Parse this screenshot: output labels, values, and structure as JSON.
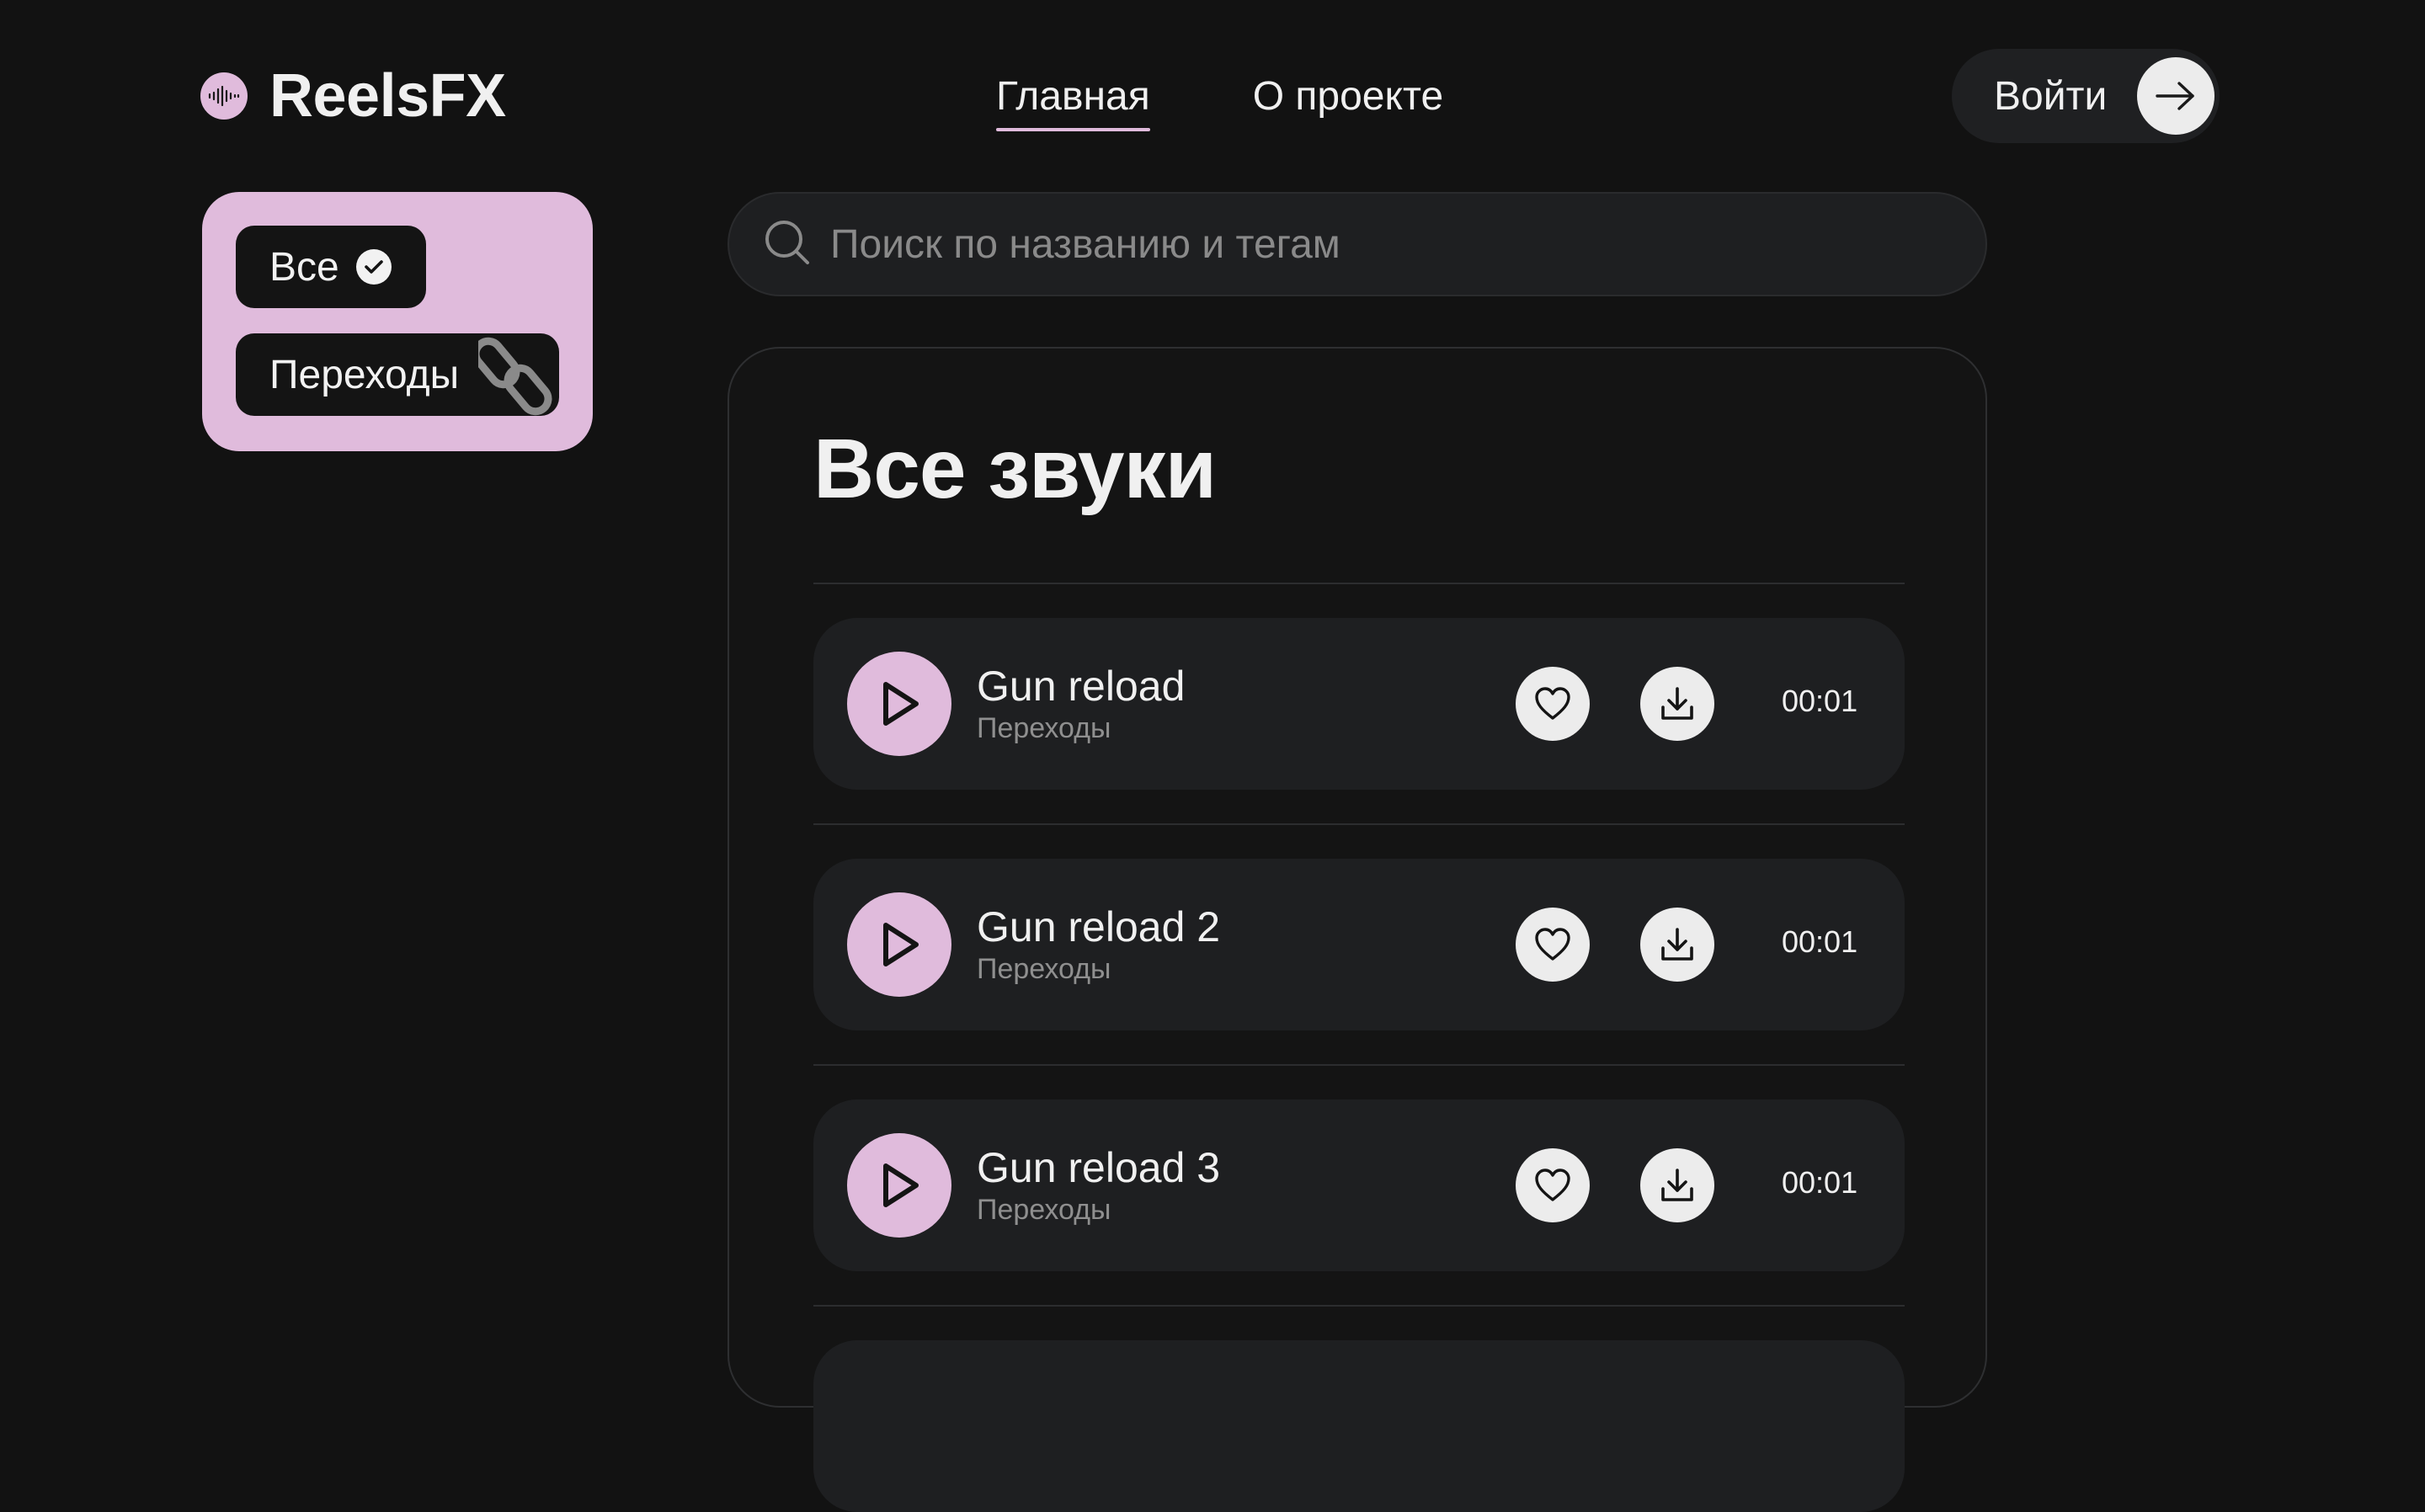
{
  "header": {
    "logo_text": "ReelsFX",
    "nav": [
      {
        "label": "Главная",
        "active": true
      },
      {
        "label": "О проекте",
        "active": false
      }
    ],
    "login_label": "Войти"
  },
  "filters": {
    "items": [
      {
        "label": "Все",
        "selected": true,
        "icon": "check-circle-icon"
      },
      {
        "label": "Переходы",
        "selected": false,
        "icon": "link-icon"
      }
    ]
  },
  "search": {
    "placeholder": "Поиск по названию и тегам",
    "value": ""
  },
  "main": {
    "title": "Все звуки",
    "sounds": [
      {
        "name": "Gun reload",
        "tag": "Переходы",
        "duration": "00:01"
      },
      {
        "name": "Gun reload 2",
        "tag": "Переходы",
        "duration": "00:01"
      },
      {
        "name": "Gun reload 3",
        "tag": "Переходы",
        "duration": "00:01"
      }
    ]
  },
  "colors": {
    "background": "#121212",
    "accent": "#e0bbdc",
    "surface": "#1e1f21",
    "text": "#f0f0f0",
    "muted": "#8f8f8f"
  }
}
